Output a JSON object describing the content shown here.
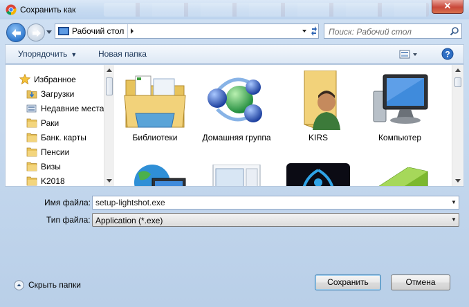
{
  "window": {
    "title": "Сохранить как",
    "close_symbol": "✕"
  },
  "address_bar": {
    "location": "Рабочий стол",
    "icon": "desktop-icon"
  },
  "search": {
    "placeholder": "Поиск: Рабочий стол"
  },
  "toolbar": {
    "organize_label": "Упорядочить",
    "new_folder_label": "Новая папка"
  },
  "nav_pane": {
    "favorites_label": "Избранное",
    "items": [
      {
        "label": "Загрузки",
        "icon": "downloads-folder-icon"
      },
      {
        "label": "Недавние места",
        "icon": "recent-places-icon"
      },
      {
        "label": "Раки",
        "icon": "folder-icon"
      },
      {
        "label": "Банк. карты",
        "icon": "folder-icon"
      },
      {
        "label": "Пенсии",
        "icon": "folder-icon"
      },
      {
        "label": "Визы",
        "icon": "folder-icon"
      },
      {
        "label": "K2018",
        "icon": "folder-icon"
      }
    ]
  },
  "content": {
    "items": [
      {
        "label": "Библиотеки",
        "icon": "libraries-icon"
      },
      {
        "label": "Домашняя группа",
        "icon": "homegroup-icon"
      },
      {
        "label": "KIRS",
        "icon": "user-folder-icon"
      },
      {
        "label": "Компьютер",
        "icon": "computer-icon"
      },
      {
        "label": "",
        "icon": "network-icon"
      },
      {
        "label": "",
        "icon": "control-panel-icon"
      },
      {
        "label": "",
        "icon": "app-shortcut-icon"
      },
      {
        "label": "",
        "icon": "green-item-icon"
      }
    ]
  },
  "file_fields": {
    "filename_label": "Имя файла:",
    "filename_value": "setup-lightshot.exe",
    "filetype_label": "Тип файла:",
    "filetype_value": "Application (*.exe)"
  },
  "footer": {
    "hide_folders_label": "Скрыть папки",
    "save_label": "Сохранить",
    "cancel_label": "Отмена"
  }
}
